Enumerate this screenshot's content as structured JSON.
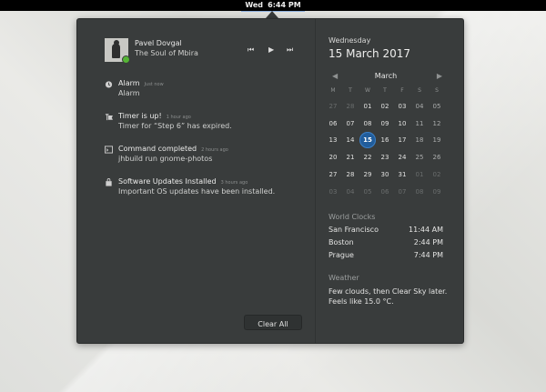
{
  "topbar": {
    "day": "Wed",
    "time": "6:44 PM"
  },
  "player": {
    "artist": "Pavel Dovgal",
    "track": "The Soul of Mbira",
    "controls": {
      "prev": "⏮",
      "play": "▶",
      "next": "⏭"
    }
  },
  "notifications": [
    {
      "icon": "alarm-clock-icon",
      "title": "Alarm",
      "time": "Just now",
      "body": "Alarm"
    },
    {
      "icon": "timer-icon",
      "title": "Timer is up!",
      "time": "1 hour ago",
      "body": "Timer for “Step 6” has expired."
    },
    {
      "icon": "terminal-icon",
      "title": "Command completed",
      "time": "2 hours ago",
      "body": "jhbuild run gnome-photos"
    },
    {
      "icon": "software-update-icon",
      "title": "Software Updates Installed",
      "time": "3 hours ago",
      "body": "Important OS updates have been installed."
    }
  ],
  "clear_all_label": "Clear All",
  "calendar": {
    "weekday": "Wednesday",
    "date": "15 March 2017",
    "month": "March",
    "weekday_headers": [
      "M",
      "T",
      "W",
      "T",
      "F",
      "S",
      "S"
    ],
    "weeks": [
      [
        "27",
        "28",
        "01",
        "02",
        "03",
        "04",
        "05"
      ],
      [
        "06",
        "07",
        "08",
        "09",
        "10",
        "11",
        "12"
      ],
      [
        "13",
        "14",
        "15",
        "16",
        "17",
        "18",
        "19"
      ],
      [
        "20",
        "21",
        "22",
        "23",
        "24",
        "25",
        "26"
      ],
      [
        "27",
        "28",
        "29",
        "30",
        "31",
        "01",
        "02"
      ],
      [
        "03",
        "04",
        "05",
        "06",
        "07",
        "08",
        "09"
      ]
    ],
    "today": "15"
  },
  "world_clocks": {
    "title": "World Clocks",
    "rows": [
      {
        "city": "San Francisco",
        "time": "11:44 AM"
      },
      {
        "city": "Boston",
        "time": "2:44 PM"
      },
      {
        "city": "Prague",
        "time": "7:44 PM"
      }
    ]
  },
  "weather": {
    "title": "Weather",
    "line1": "Few clouds, then Clear Sky later.",
    "line2": "Feels like 15.0 °C."
  },
  "colors": {
    "today_highlight": "#215d9c",
    "popover_bg": "#393c3c",
    "topbar_bg": "#000000"
  }
}
